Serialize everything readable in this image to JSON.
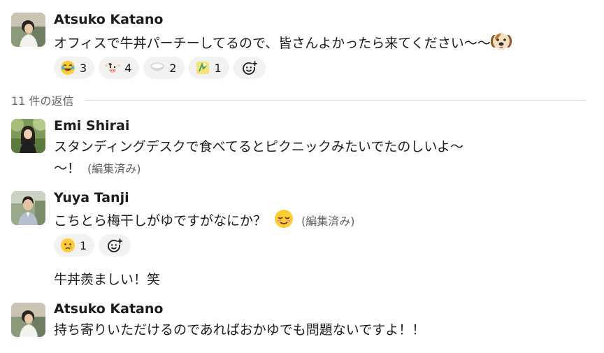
{
  "thread": {
    "replies_label": "11 件の返信",
    "edited_label": "(編集済み)"
  },
  "messages": [
    {
      "author": "Atsuko Katano",
      "text": "オフィスで牛丼パーチーしてるので、皆さんよかったら来てください〜〜",
      "trailing_emoji": "dog-face",
      "reactions": [
        {
          "emoji": "joy",
          "count": "3"
        },
        {
          "emoji": "cow",
          "count": "4"
        },
        {
          "emoji": "rice-bowl",
          "count": "2"
        },
        {
          "emoji": "kirakira-yellow",
          "count": "1"
        }
      ]
    },
    {
      "author": "Emi Shirai",
      "text_line1": "スタンディングデスクで食べてるとピクニックみたいでたのしいよ〜",
      "text_line2": "〜！",
      "edited": true
    },
    {
      "author": "Yuya Tanji",
      "text": "こちとら梅干しがゆですがなにか？",
      "trailing_emoji": "relieved-face",
      "edited": true,
      "reactions": [
        {
          "emoji": "crying-face",
          "count": "1"
        }
      ]
    },
    {
      "author": "Yuya Tanji",
      "continuation": true,
      "text": "牛丼羨ましい！笑"
    },
    {
      "author": "Atsuko Katano",
      "text": "持ち寄りいただけるのであればおかゆでも問題ないですよ！！"
    }
  ],
  "colors": {
    "text": "#1d1c1d",
    "muted": "#616061",
    "pill_bg": "#f2f2f2",
    "divider": "#dddddd"
  },
  "icons": {
    "add_reaction": "add-reaction-icon"
  }
}
